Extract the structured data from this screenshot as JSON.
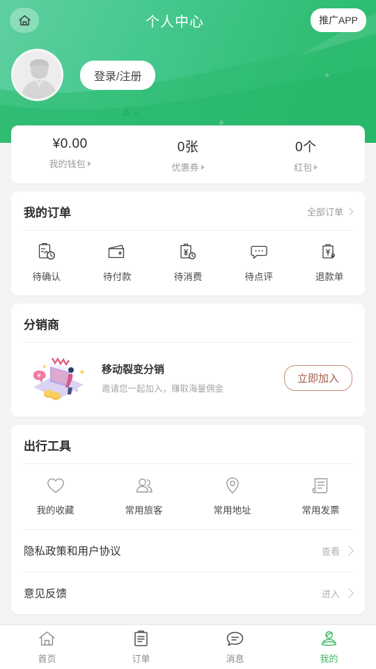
{
  "header": {
    "title": "个人中心",
    "home_icon": "home-icon",
    "promo_label": "推广APP",
    "login_label": "登录/注册",
    "avatar_icon": "default-avatar-icon"
  },
  "wallet": {
    "stats": [
      {
        "value": "¥0.00",
        "label": "我的钱包"
      },
      {
        "value": "0张",
        "label": "优惠券"
      },
      {
        "value": "0个",
        "label": "红包"
      }
    ]
  },
  "orders": {
    "title": "我的订单",
    "more_label": "全部订单",
    "items": [
      {
        "label": "待确认",
        "icon": "clipboard-clock-icon"
      },
      {
        "label": "待付款",
        "icon": "wallet-icon"
      },
      {
        "label": "待消费",
        "icon": "clipboard-yuan-clock-icon"
      },
      {
        "label": "待点评",
        "icon": "comment-dots-icon"
      },
      {
        "label": "退款单",
        "icon": "clipboard-refund-icon"
      }
    ]
  },
  "distributor": {
    "title": "分销商",
    "item_title": "移动裂变分销",
    "item_sub": "邀请您一起加入，赚取海量佣金",
    "join_label": "立即加入",
    "illustration_icon": "mobile-store-coins-illustration"
  },
  "tools": {
    "title": "出行工具",
    "items": [
      {
        "label": "我的收藏",
        "icon": "heart-icon"
      },
      {
        "label": "常用旅客",
        "icon": "users-icon"
      },
      {
        "label": "常用地址",
        "icon": "location-pin-icon"
      },
      {
        "label": "常用发票",
        "icon": "invoice-icon"
      }
    ]
  },
  "links": [
    {
      "label": "隐私政策和用户协议",
      "action": "查看"
    },
    {
      "label": "意见反馈",
      "action": "进入"
    }
  ],
  "tabbar": {
    "items": [
      {
        "label": "首页",
        "icon": "home-icon",
        "active": false
      },
      {
        "label": "订单",
        "icon": "order-icon",
        "active": false
      },
      {
        "label": "消息",
        "icon": "message-icon",
        "active": false
      },
      {
        "label": "我的",
        "icon": "profile-icon",
        "active": true
      }
    ]
  },
  "colors": {
    "brand_green": "#3fb865",
    "hero_gradient_start": "#5fd0a0",
    "hero_gradient_end": "#28b96c",
    "join_accent": "#a05c4a",
    "page_bg": "#f4f4f4",
    "card_bg": "#ffffff"
  }
}
